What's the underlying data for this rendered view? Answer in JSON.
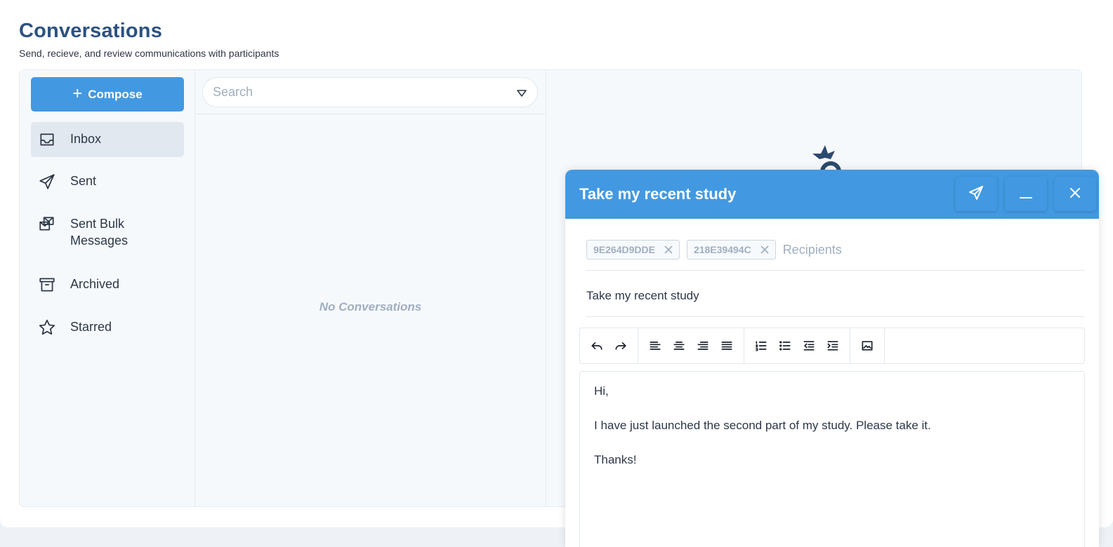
{
  "page": {
    "title": "Conversations",
    "subtitle": "Send, recieve, and review communications with participants"
  },
  "sidebar": {
    "compose_label": "Compose",
    "items": [
      {
        "label": "Inbox",
        "icon": "inbox-icon",
        "active": true
      },
      {
        "label": "Sent",
        "icon": "paper-plane-icon"
      },
      {
        "label": "Sent Bulk Messages",
        "icon": "bulk-mail-icon"
      },
      {
        "label": "Archived",
        "icon": "archive-box-icon"
      },
      {
        "label": "Starred",
        "icon": "star-icon"
      }
    ]
  },
  "list": {
    "search_placeholder": "Search",
    "empty_text": "No Conversations"
  },
  "compose": {
    "title": "Take my recent study",
    "recipients": [
      "9E264D9DDE",
      "218E39494C"
    ],
    "recipients_placeholder": "Recipients",
    "subject": "Take my recent study",
    "body": [
      "Hi,",
      "I have just launched the second part of my study. Please take it.",
      "Thanks!"
    ],
    "header_buttons": [
      "send-icon",
      "minimize-icon",
      "close-icon"
    ]
  },
  "colors": {
    "accent": "#4299e1",
    "title": "#2c5282",
    "muted": "#a0aec0"
  }
}
